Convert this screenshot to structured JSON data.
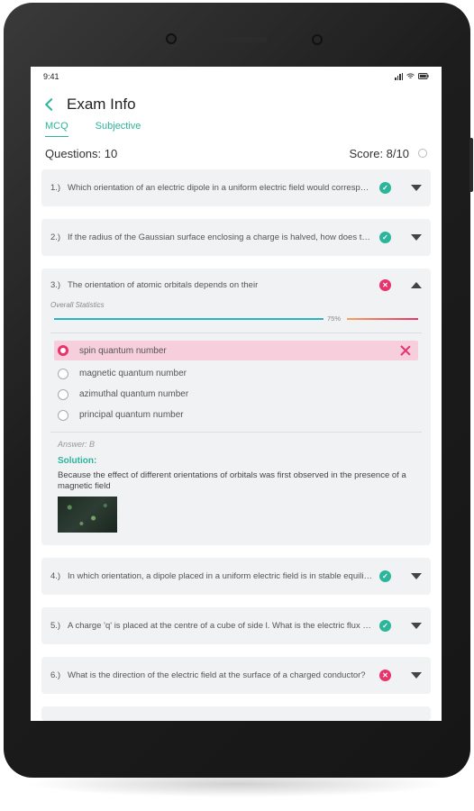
{
  "status_bar": {
    "time": "9:41",
    "icons": [
      "signal-icon",
      "wifi-icon",
      "battery-icon"
    ]
  },
  "header": {
    "title": "Exam Info",
    "back_icon": "back-arrow-icon"
  },
  "tabs": [
    {
      "label": "MCQ",
      "active": true
    },
    {
      "label": "Subjective",
      "active": false
    }
  ],
  "summary": {
    "questions": "Questions: 10",
    "score": "Score: 8/10"
  },
  "colors": {
    "accent": "#2bb59a",
    "wrong": "#e8336b",
    "card_bg": "#f1f2f3",
    "selected_bg": "#f7cfdc"
  },
  "questions": [
    {
      "num": "1.)",
      "text": "Which orientation of an electric dipole in a uniform electric field would correspond to stable equilibrium?",
      "status": "correct"
    },
    {
      "num": "2.)",
      "text": "If the radius of the Gaussian surface enclosing a charge is halved, how does the electric flux change?",
      "status": "correct"
    },
    {
      "num": "3.)",
      "text": "The orientation of atomic orbitals depends on their",
      "status": "wrong",
      "expanded": true,
      "stats_label": "Overall Statistics",
      "stats_percent_label": "75%",
      "stats_value": 0.75,
      "options": [
        {
          "label": "spin quantum number",
          "selected": true,
          "wrong": true
        },
        {
          "label": "magnetic quantum number",
          "selected": false
        },
        {
          "label": "azimuthal quantum number",
          "selected": false
        },
        {
          "label": "principal quantum number",
          "selected": false
        }
      ],
      "answer": "Answer: B",
      "solution_title": "Solution:",
      "solution_text": "Because the effect of different orientations of orbitals was first observed in the presence of a magnetic field"
    },
    {
      "num": "4.)",
      "text": "In which orientation, a dipole placed in a uniform electric field is in stable equilibrium?",
      "status": "correct"
    },
    {
      "num": "5.)",
      "text": "A charge 'q' is placed at the centre of a cube of side l. What is the electric flux passing through each face?",
      "status": "correct"
    },
    {
      "num": "6.)",
      "text": "What is the direction of the electric field at the surface of a charged conductor?",
      "status": "wrong"
    }
  ]
}
